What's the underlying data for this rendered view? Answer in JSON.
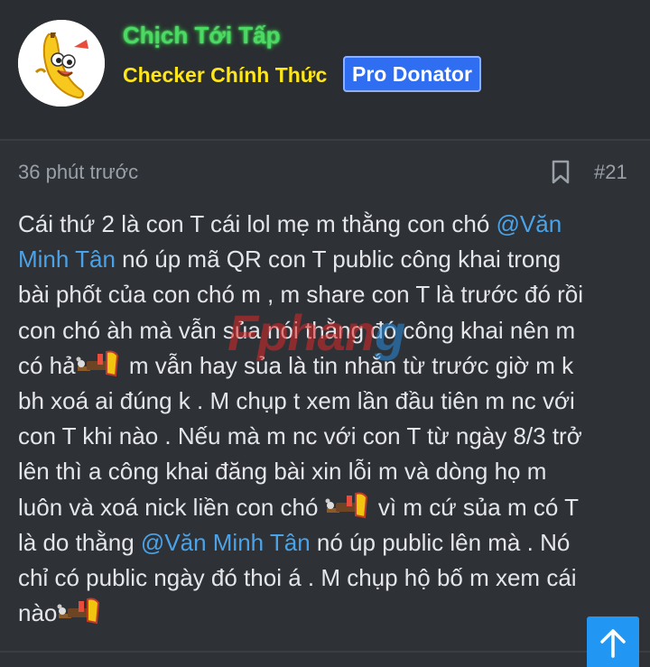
{
  "user": {
    "name": "Chịch Tới Tấp",
    "title": "Checker Chính Thức",
    "badge": "Pro Donator"
  },
  "post": {
    "time": "36 phút trước",
    "number": "#21",
    "lines": {
      "l1a": "Cái thứ 2 là con T cái lol mẹ m thằng con chó ",
      "l1b": "@Văn",
      "l2a": "Minh Tân",
      "l2b": " nó úp mã QR con T public công khai trong",
      "l3": "bài phốt của con chó m , m share con T là trước đó rồi",
      "l4": "con chó àh mà vẫn sủa nói thằng đó công khai nên m",
      "l5a": "có hả",
      "l5b": " m vẫn hay sủa là tin nhắn từ trước giờ m k",
      "l6": "bh xoá ai đúng k . M chụp t xem lần đầu tiên m nc với",
      "l7": "con T khi nào . Nếu mà m nc với con T từ ngày 8/3 trở",
      "l8": "lên thì a công khai đăng bài xin lỗi m và dòng họ m",
      "l9a": "luôn và xoá nick liền con chó ",
      "l9b": " vì m cứ sủa m có T",
      "l10a": "là do thằng ",
      "l10b": "@Văn Minh Tân",
      "l10c": " nó úp public lên mà . Nó",
      "l11": "chỉ có public ngày đó thoi á . M chụp hộ bố m xem cái",
      "l12": "nào"
    }
  },
  "watermark": {
    "part1": "Fphan",
    "part2": "g"
  },
  "icons": {
    "bookmark": "bookmark-icon",
    "scroll_top": "arrow-up-icon",
    "emoji": "gun-emoji-icon",
    "avatar": "banana-avatar"
  },
  "colors": {
    "background": "#2e3136",
    "username": "#4cd964",
    "title": "#ffe61a",
    "badge": "#2f6ef0",
    "mention": "#4aa3e8",
    "scroll_button": "#2196f3"
  }
}
